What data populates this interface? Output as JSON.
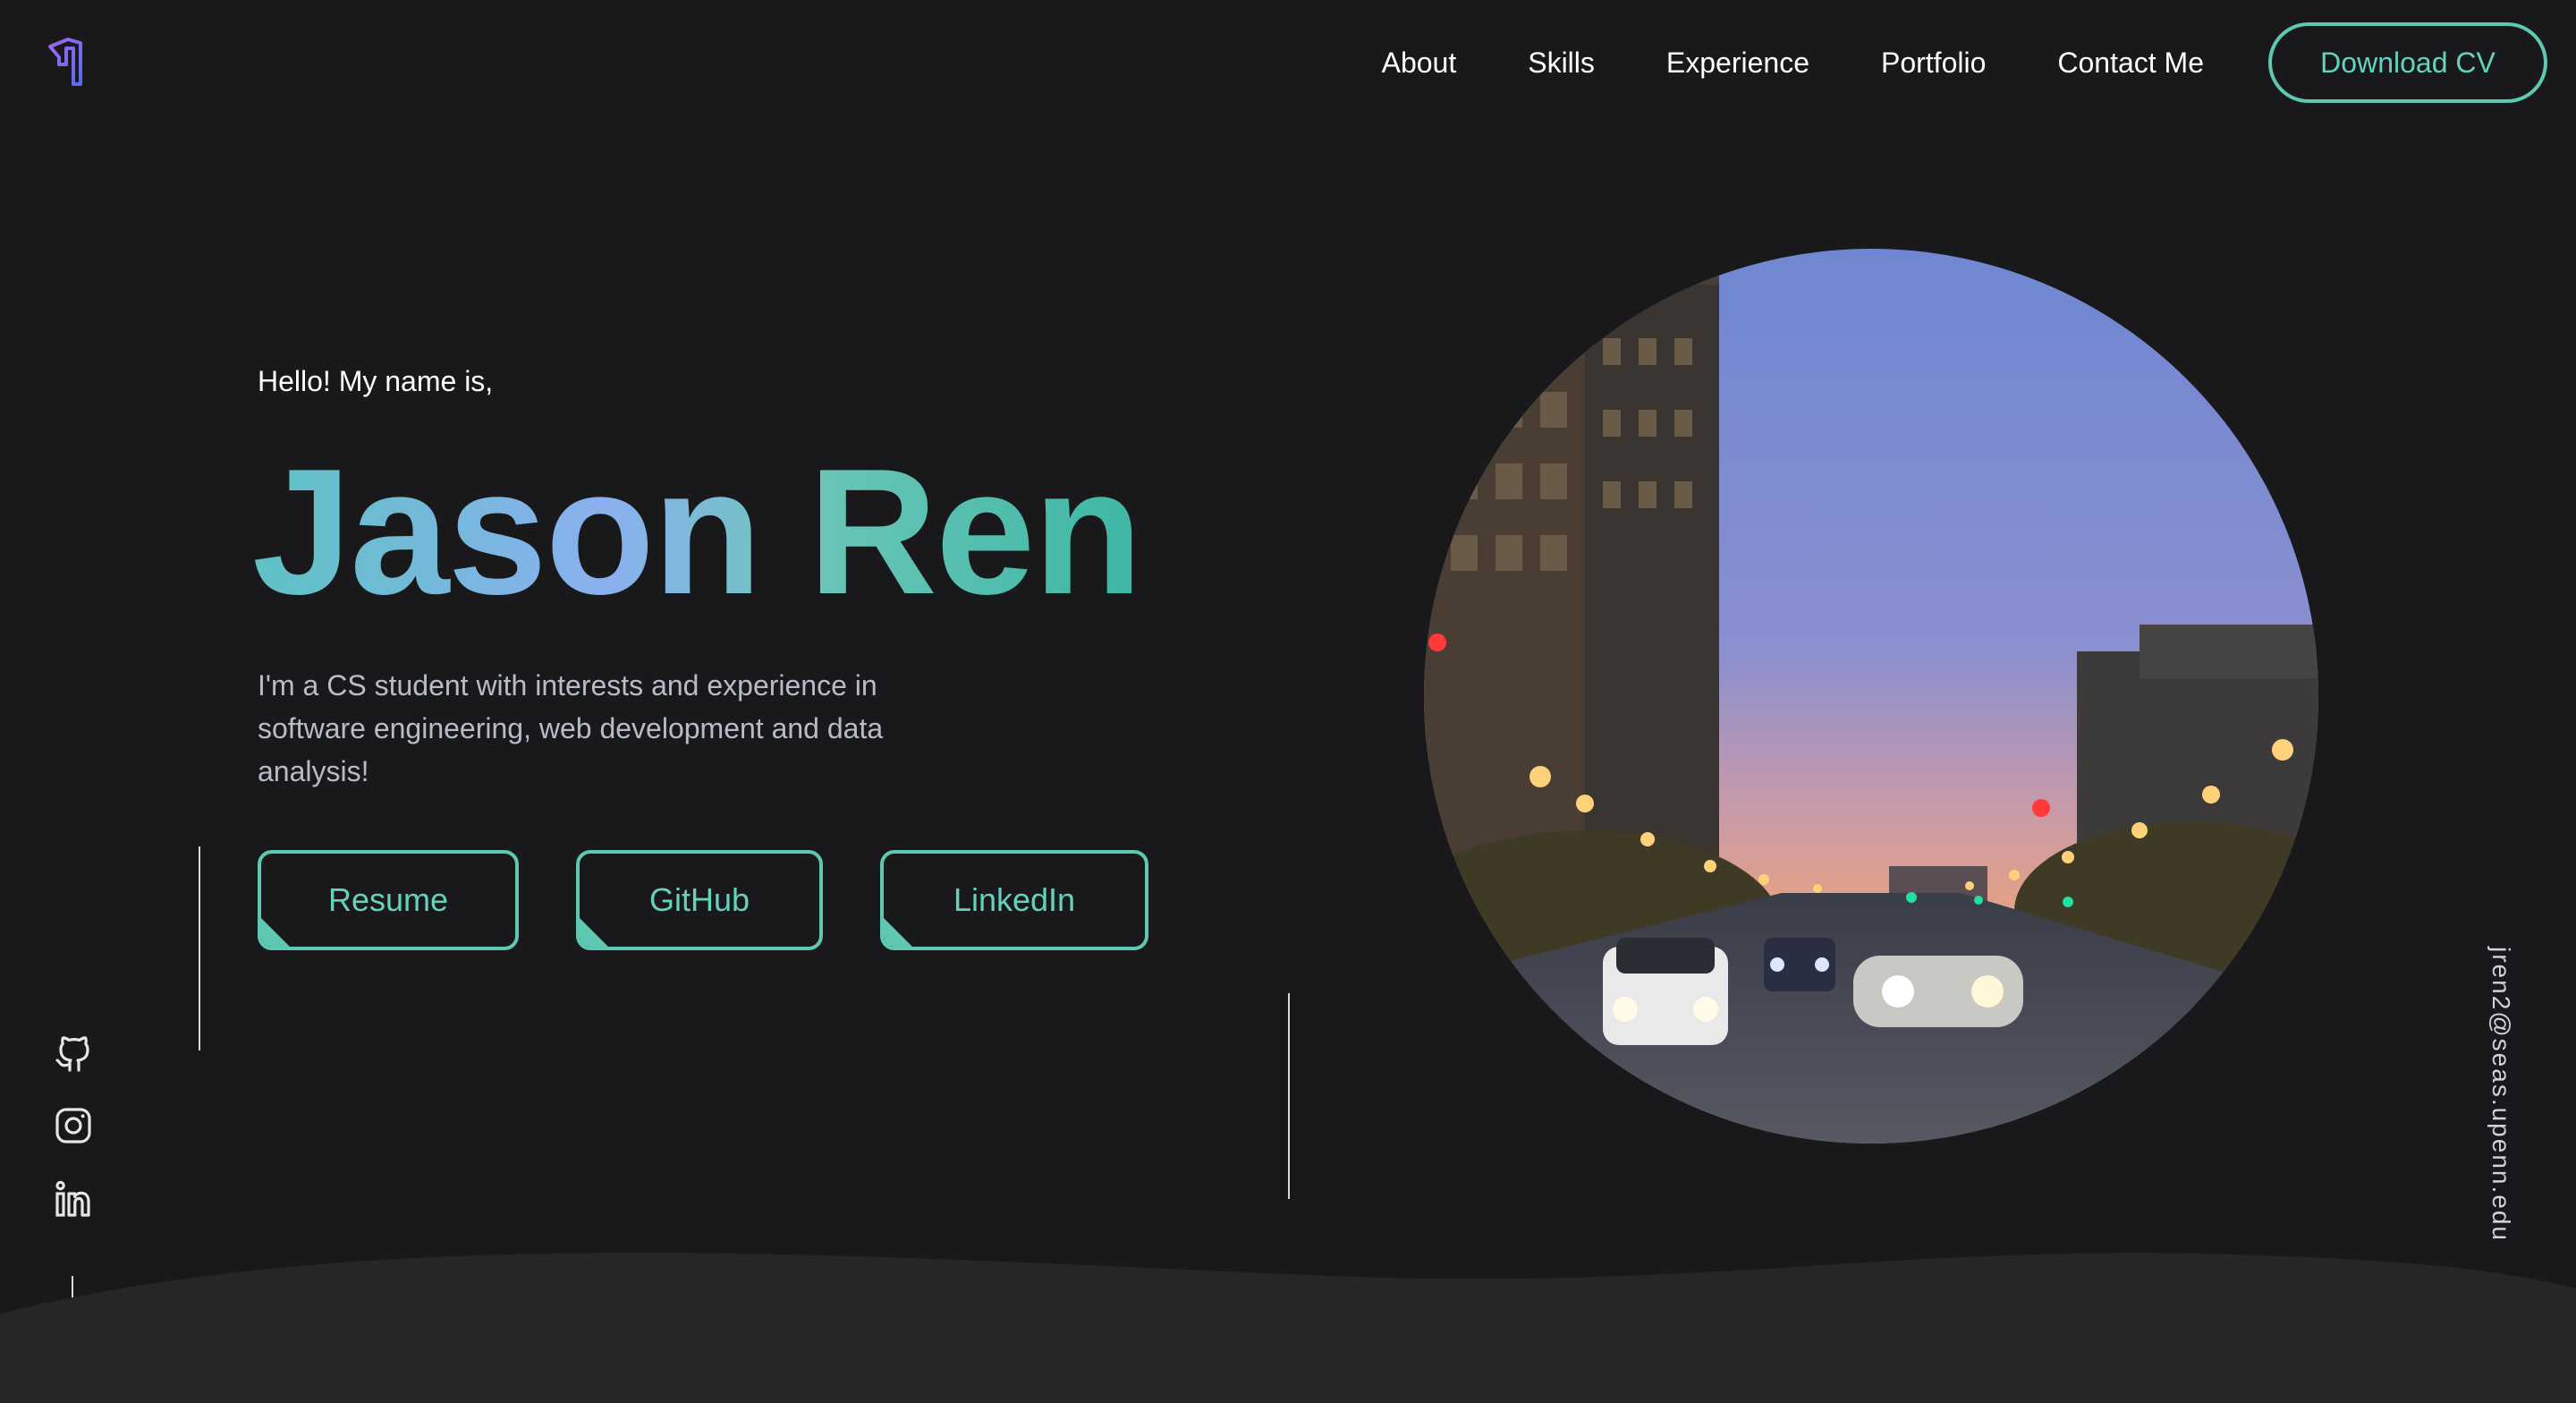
{
  "header": {
    "logo": "shield-logo",
    "nav": [
      "About",
      "Skills",
      "Experience",
      "Portfolio",
      "Contact Me"
    ],
    "cta_label": "Download CV"
  },
  "hero": {
    "greeting": "Hello! My name is,",
    "name": "Jason Ren",
    "description": "I'm a CS student with interests and experience in software engineering, web development and data analysis!",
    "buttons": [
      "Resume",
      "GitHub",
      "LinkedIn"
    ],
    "photo": "city street at dusk with cars and lights"
  },
  "socials": [
    "github-icon",
    "instagram-icon",
    "linkedin-icon"
  ],
  "email": "jren2@seas.upenn.edu",
  "colors": {
    "background": "#19191b",
    "accent": "#5ec8b3",
    "wave": "#262628"
  }
}
